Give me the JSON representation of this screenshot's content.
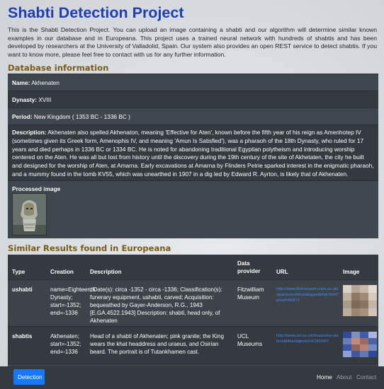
{
  "page": {
    "title": "Shabti Detection Project",
    "intro": "This is the Shabti Detection Project. You can upload an image containing a shabti and our algorithm will determine similar known examples in our database and in Europeana. This project uses a trained neural network with hundreds of shabtis and has been developed by researchers at the University of Valladolid, Spain. Our system also provides an open REST service to detect shabtis. If you want to know more, please feel free to contact with us for any further information."
  },
  "database": {
    "heading": "Database information",
    "name_label": "Name:",
    "name_value": "Akhenaten",
    "dynasty_label": "Dynasty:",
    "dynasty_value": "XVIII",
    "period_label": "Period:",
    "period_value": "New Kingdom ( 1353 BC - 1336 BC )",
    "description_label": "Description:",
    "description_value": "Akhenaten also spelled Akhenaton, meaning 'Effective for Aten', known before the fifth year of his reign as Amenhotep IV (sometimes given its Greek form, Amenophis IV, and meaning 'Amun Is Satisfied'), was a pharaoh of the 18th Dynasty, who ruled for 17 years and died perhaps in 1336 BC or 1334 BC. He is noted for abandoning traditional Egyptian polytheism and introducing worship centered on the Aten. He was all but lost from history until the discovery during the 19th century of the site of Akhetaten, the city he built and designed for the worship of Aten, at Amarna. Early excavations at Amarna by Flinders Petrie sparked interest in the enigmatic pharaoh, and a mummy found in the tomb KV55, which was unearthed in 1907 in a dig led by Edward R. Ayrton, is likely that of Akhenaten.",
    "processed_image_label": "Processed image"
  },
  "results": {
    "heading": "Similar Results found in Europeana",
    "columns": {
      "type": "Type",
      "creation": "Creation",
      "description": "Description",
      "provider": "Data provider",
      "url": "URL",
      "image": "Image"
    },
    "rows": [
      {
        "type": "ushabti",
        "creation": "name=Eighteenth Dynasty; start=-1352; end=-1336",
        "description": "; Date(s): circa -1352 - circa -1336; Classification(s): funerary equipment, ushabti, carved; Acquisition: bequeathed by Gayer-Anderson, R.G., 1943 [E.GA.4522.1943] Description: shabti, head only, of Akhenaten",
        "provider": "Fitzwilliam Museum",
        "url": "http://www.fitzmuseum.cam.ac.uk/opac/search/cataloguedetail.html?priref=56973"
      },
      {
        "type": "shabtis",
        "creation": "Akhenaten; start=-1352; end=-1336",
        "description": "Head of a shabti of Akhenaten; pink granite; the King wears the khat headdress and uraeus, and Osirian beard. The portrait is of Tutankhamen cast.",
        "provider": "UCL Museums",
        "url": "http://www.ucl.ac.uk/museums-static/obl4he/objects/UC002007"
      }
    ]
  },
  "navbar": {
    "detect_label": "Detection",
    "links": [
      "Home",
      "About",
      "Contact"
    ]
  },
  "colors": {
    "title": "#1f3fae",
    "section_heading": "#7a5d14",
    "panel": "#383d43",
    "button": "#1479ff",
    "link": "#3f8cff"
  }
}
